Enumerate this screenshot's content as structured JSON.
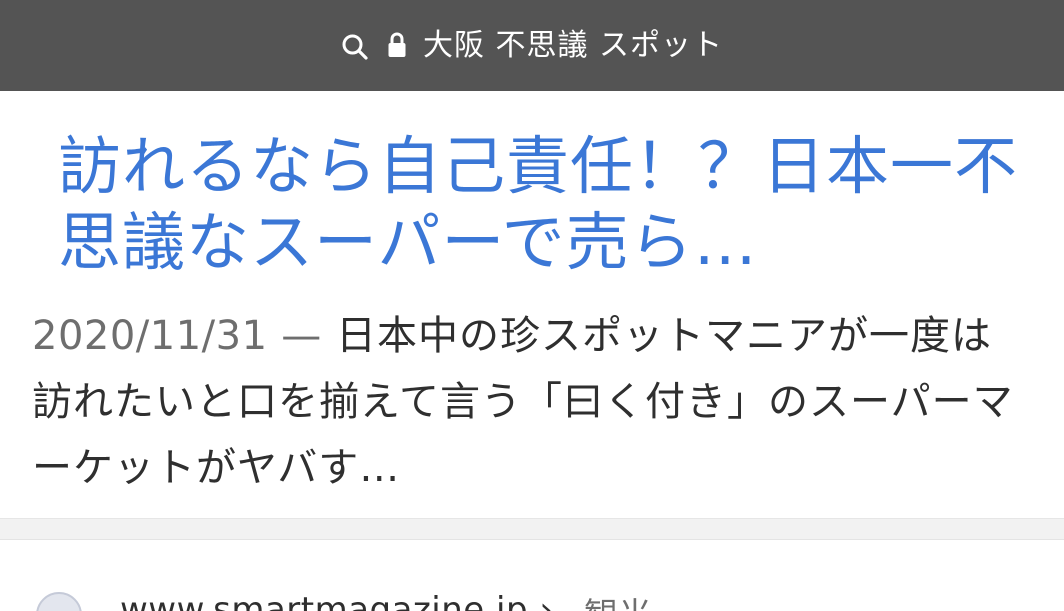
{
  "search_bar": {
    "query": "大阪 不思議 スポット"
  },
  "result": {
    "title": "訪れるなら自己責任！？日本一不思議なスーパーで売ら…",
    "date": "2020/11/31",
    "separator": "—",
    "snippet": "日本中の珍スポットマニアが一度は訪れたいと口を揃えて言う「曰く付き」のスーパーマーケットがヤバす…"
  },
  "next_result": {
    "source": "www.smartmagazine.jp",
    "separator": "›",
    "category": "観光"
  },
  "colors": {
    "topbar_bg": "#545454",
    "title_link": "#3b77d6",
    "snippet_text": "#2f2f2f",
    "muted_text": "#6e6e6e"
  },
  "icons": [
    "search-icon",
    "lock-icon",
    "site-favicon-icon"
  ]
}
